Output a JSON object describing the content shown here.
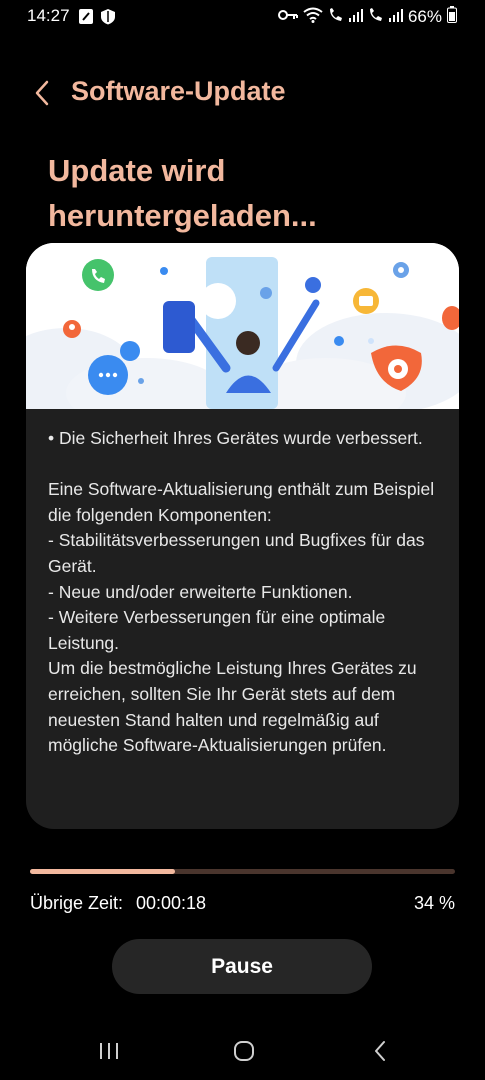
{
  "status_bar": {
    "time": "14:27",
    "battery_percent": "66%",
    "icons": [
      "notification-icon",
      "shield-icon",
      "key-icon",
      "wifi-icon",
      "call-icon",
      "signal-icon",
      "call-icon-2",
      "signal-icon-2",
      "battery-icon"
    ]
  },
  "header": {
    "title": "Software-Update"
  },
  "status_heading": "Update wird heruntergeladen...",
  "notes_text": "• Die Sicherheit Ihres Gerätes wurde verbessert.\n\nEine Software-Aktualisierung enthält zum Beispiel die folgenden Komponenten:\n - Stabilitätsverbesserungen und Bugfixes für das Gerät.\n - Neue und/oder erweiterte Funktionen.\n - Weitere Verbesserungen für eine optimale Leistung.\nUm die bestmögliche Leistung Ihres Gerätes zu erreichen, sollten Sie Ihr Gerät stets auf dem neuesten Stand halten und regelmäßig auf mögliche Software-Aktualisierungen prüfen.",
  "progress": {
    "value": 0.34,
    "remaining_label": "Übrige Zeit:",
    "remaining_value": "00:00:18",
    "percent_text": "34 %"
  },
  "pause_label": "Pause",
  "colors": {
    "accent": "#f2b89e",
    "card_bg": "#1f1f1f",
    "progress_track": "#4a352d",
    "illustration_orange": "#f2673a",
    "illustration_blue": "#3a6fe0"
  },
  "nav": {
    "icons": [
      "recents-icon",
      "home-icon",
      "back-nav-icon"
    ]
  }
}
